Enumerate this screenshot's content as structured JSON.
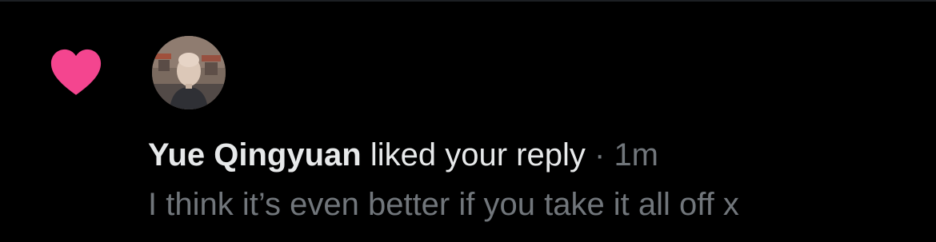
{
  "notification": {
    "icon": "heart-icon",
    "icon_color": "#f4458f",
    "user_name": "Yue Qingyuan",
    "action": "liked your reply",
    "separator": "·",
    "timestamp": "1m",
    "reply_text": "I think it’s even better if you take it all off x"
  },
  "colors": {
    "background": "#000000",
    "primary_text": "#e7e9ea",
    "secondary_text": "#71767b"
  }
}
